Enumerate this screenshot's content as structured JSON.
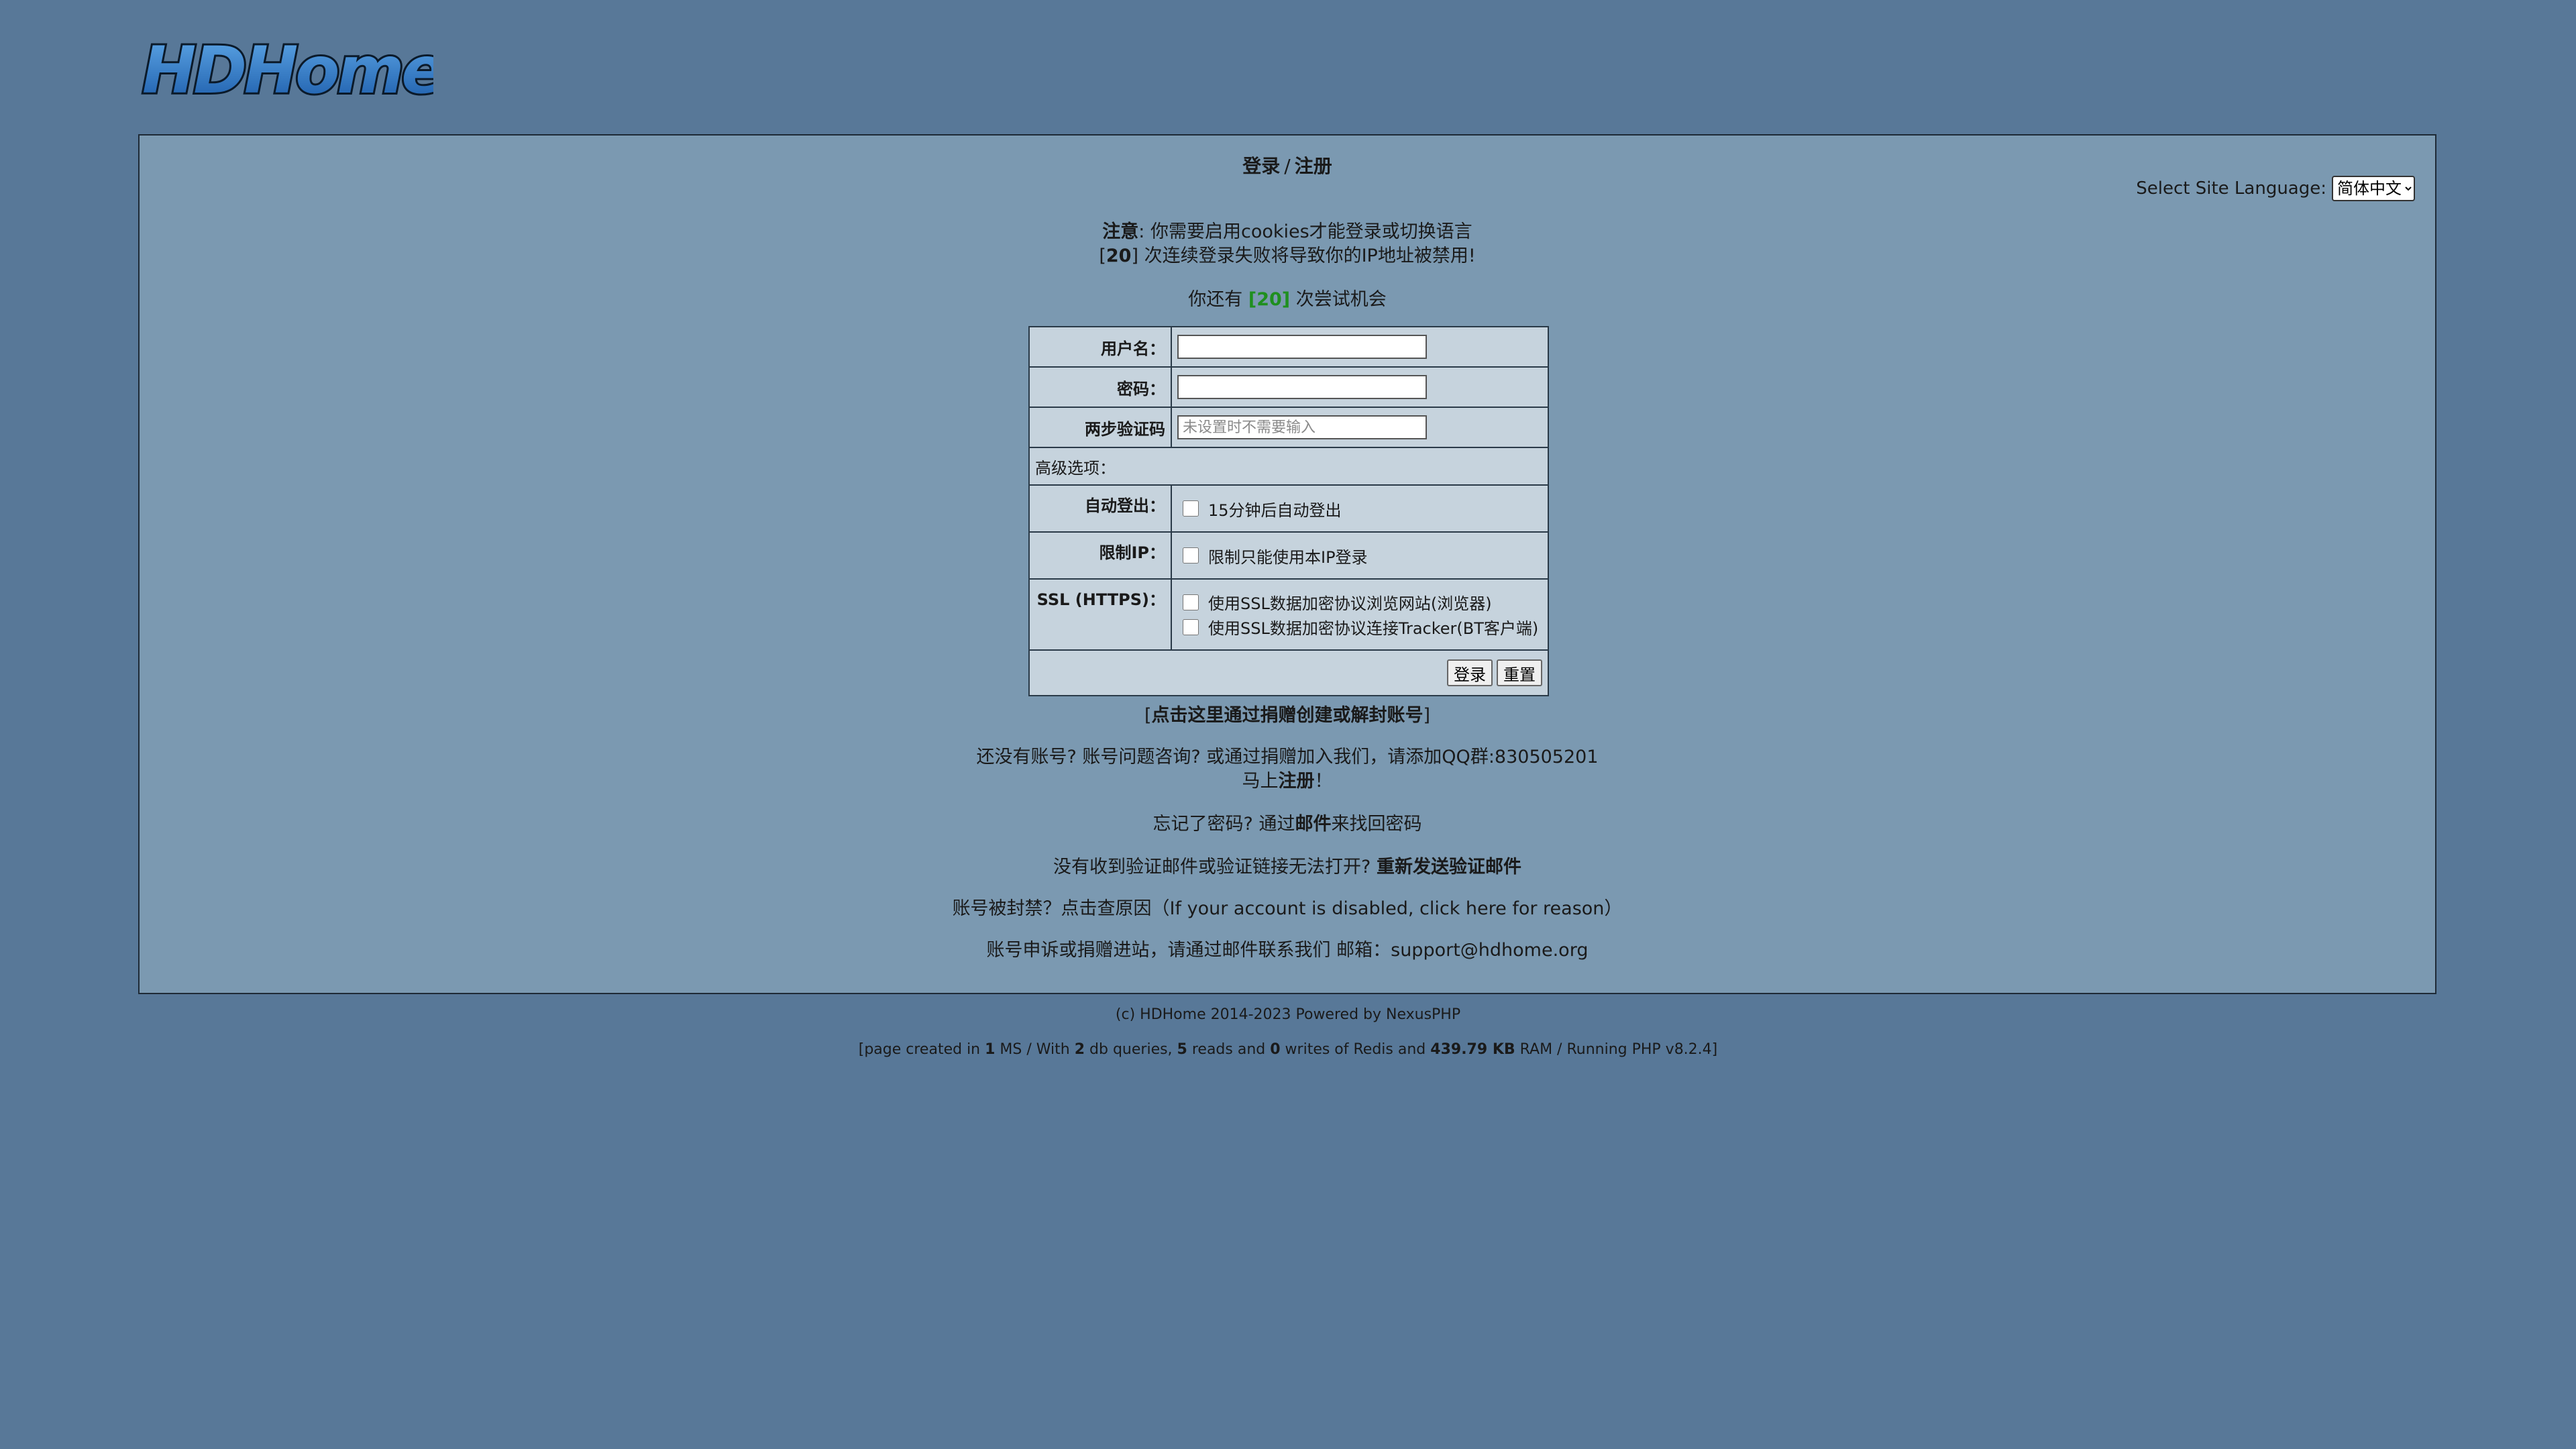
{
  "logo": {
    "text": "HDHome"
  },
  "header": {
    "title_login": "登录",
    "title_sep": "/",
    "title_register": "注册"
  },
  "language": {
    "label": "Select Site Language:",
    "selected": "简体中文"
  },
  "notice": {
    "label": "注意",
    "text": ": 你需要启用cookies才能登录或切换语言",
    "attempts_bracket_open": "[",
    "attempts_count": "20",
    "attempts_text": "] 次连续登录失败将导致你的IP地址被禁用!"
  },
  "tries": {
    "prefix": "你还有",
    "count": "[20]",
    "suffix": "次尝试机会"
  },
  "form": {
    "username_label": "用户名：",
    "password_label": "密码：",
    "twofa_label": "两步验证码",
    "twofa_placeholder": "未设置时不需要输入",
    "advanced_label": "高级选项：",
    "autologout_label": "自动登出：",
    "autologout_option": "15分钟后自动登出",
    "restrict_ip_label": "限制IP：",
    "restrict_ip_option": "限制只能使用本IP登录",
    "ssl_label": "SSL (HTTPS)：",
    "ssl_option_browse": "使用SSL数据加密协议浏览网站(浏览器)",
    "ssl_option_tracker": "使用SSL数据加密协议连接Tracker(BT客户端)",
    "login_button": "登录",
    "reset_button": "重置"
  },
  "links": {
    "donate_open": "[",
    "donate_text": "点击这里通过捐赠创建或解封账号",
    "donate_close": "]",
    "qq_text": "还没有账号? 账号问题咨询? 或通过捐赠加入我们，请添加QQ群:830505201",
    "register_prefix": "马上",
    "register_link": "注册",
    "register_suffix": "！",
    "forgot_prefix": "忘记了密码? 通过",
    "forgot_link": "邮件",
    "forgot_suffix": "来找回密码",
    "resend_prefix": "没有收到验证邮件或验证链接无法打开?",
    "resend_link": "重新发送验证邮件",
    "disabled_text": "账号被封禁？点击查原因（If your account is disabled, click here for reason）",
    "appeal_text": "账号申诉或捐赠进站，请通过邮件联系我们 邮箱：support@hdhome.org"
  },
  "footer": {
    "copyright": "(c) HDHome 2014-2023 Powered by NexusPHP",
    "stats_1": "[page created in ",
    "stats_ms": "1",
    "stats_2": " MS / With ",
    "stats_queries": "2",
    "stats_3": " db queries, ",
    "stats_reads": "5",
    "stats_4": " reads and ",
    "stats_writes": "0",
    "stats_5": " writes of Redis and ",
    "stats_ram": "439.79 KB",
    "stats_6": " RAM / Running PHP v8.2.4]"
  },
  "colors": {
    "background": "#587898",
    "panel": "#7b99b1",
    "table": "#c6d3dd",
    "tries_highlight": "#1f8f1f"
  }
}
